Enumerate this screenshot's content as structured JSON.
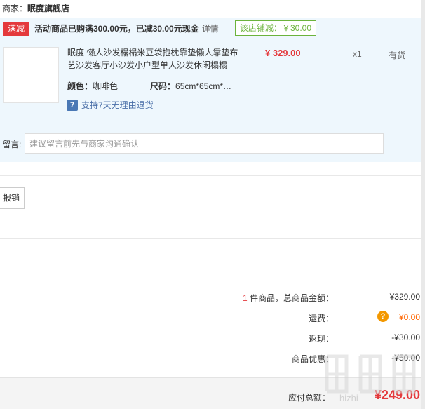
{
  "merchant": {
    "label": "商家：",
    "name": "眠度旗舰店"
  },
  "promo": {
    "badge": "满减",
    "text": "活动商品已购满300.00元，已减30.00元现金",
    "detail_link": "详情",
    "discount": "该店铺减：￥30.00"
  },
  "product": {
    "title": "眠度 懒人沙发榻榻米豆袋抱枕靠垫懒人靠垫布艺沙发客厅小沙发小户型单人沙发休闲榻榻",
    "price": "¥ 329.00",
    "quantity": "x1",
    "stock": "有货",
    "color_label": "颜色：",
    "color_value": "咖啡色",
    "size_label": "尺码：",
    "size_value": "65cm*65cm*…",
    "return_icon": "7",
    "return_policy": "支持7天无理由退货"
  },
  "comment": {
    "label": "留言:",
    "placeholder": "建议留言前先与商家沟通确认"
  },
  "reimburse_button": "报销",
  "summary": {
    "count": "1",
    "count_suffix": " 件商品，总商品金额：",
    "goods_total": "¥329.00",
    "shipping_label": "运费：",
    "shipping_value": "¥0.00",
    "rebate_label": "返现：",
    "rebate_value": "-¥30.00",
    "discount_label": "商品优惠：",
    "discount_value": "-¥50.00",
    "total_label": "应付总额：",
    "total_value": "¥249.00"
  },
  "watermark": {
    "text": "hizhi"
  },
  "colors": {
    "red": "#e4393c",
    "green": "#6bb33c",
    "orange": "#f39800",
    "panel_bg": "#eef7fd"
  }
}
